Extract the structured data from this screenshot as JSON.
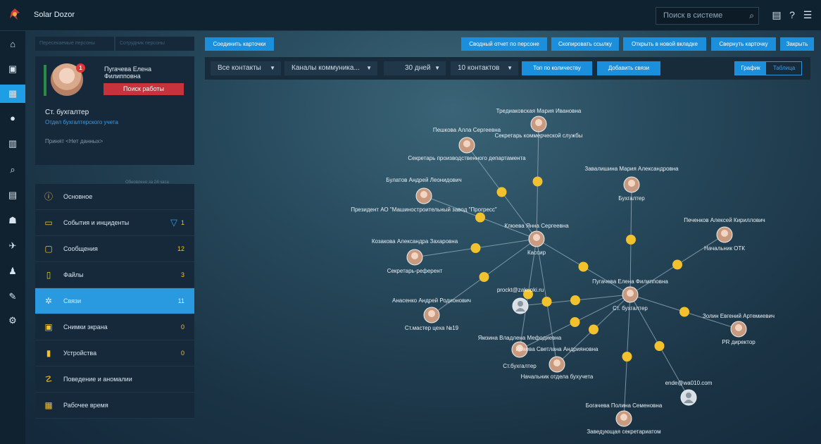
{
  "app": {
    "title": "Solar Dozor"
  },
  "search": {
    "placeholder": "Поиск в системе"
  },
  "colors": {
    "accent": "#1f9ee6",
    "badge": "#f2c12e",
    "danger": "#c8323a"
  },
  "left_nav": [
    "home-icon",
    "dashboard-icon",
    "persons-icon",
    "security-icon",
    "reports-icon",
    "search-icon",
    "table-icon",
    "spy-icon",
    "plane-icon",
    "user-icon",
    "edit-icon",
    "settings-icon"
  ],
  "panel_tabs": [
    "Пересекаемые персоны",
    "Сотрудник персоны"
  ],
  "profile": {
    "name": "Пугачева Елена Филипповна",
    "badge": "1",
    "job_button": "Поиск работы",
    "role": "Ст. бухгалтер",
    "department": "Отдел бухгалтерского учета",
    "hired": "Принят <Нет данных>",
    "updated": "Обновлено за 24 часа"
  },
  "menu": [
    {
      "label": "Основное",
      "count": "",
      "icon": "info-icon"
    },
    {
      "label": "События и инциденты",
      "count": "1",
      "icon": "events-icon"
    },
    {
      "label": "Сообщения",
      "count": "12",
      "icon": "message-icon"
    },
    {
      "label": "Файлы",
      "count": "3",
      "icon": "file-icon"
    },
    {
      "label": "Связи",
      "count": "11",
      "icon": "links-icon"
    },
    {
      "label": "Снимки экрана",
      "count": "0",
      "icon": "screenshot-icon"
    },
    {
      "label": "Устройства",
      "count": "0",
      "icon": "device-icon"
    },
    {
      "label": "Поведение и аномалии",
      "count": "",
      "icon": "anomaly-icon"
    },
    {
      "label": "Рабочее время",
      "count": "",
      "icon": "worktime-icon"
    }
  ],
  "toolbar": {
    "connect": "Соединить карточки",
    "report": "Сводный отчет по персоне",
    "copy": "Скопировать ссылку",
    "open_tab": "Открыть в новой вкладке",
    "collapse": "Свернуть карточку",
    "close": "Закрыть"
  },
  "filters": {
    "contacts": "Все контакты",
    "channels": "Каналы коммуника...",
    "period": "30 дней",
    "limit": "10 контактов",
    "sort": "Топ по количеству",
    "add": "Добавить связи",
    "view_graph": "График",
    "view_table": "Таблица"
  },
  "graph": {
    "center": {
      "name": "Пугачева Елена Филипповна",
      "role": "Ст. бухгалтер"
    },
    "hub": {
      "name": "Клюева Янна Сергеевна",
      "role": "Кассир"
    },
    "nodes": [
      {
        "name": "Тредиаковская Мария Ивановна",
        "role": "Секретарь коммерческой службы"
      },
      {
        "name": "Пешкова Алла Сергеевна",
        "role": "Секретарь производственного департамента"
      },
      {
        "name": "Булатов Андрей Леонидович",
        "role": "Президент АО \"Машиностроительный завод \"Прогресс\""
      },
      {
        "name": "Завалишина Мария Александровна",
        "role": "Бухгалтер"
      },
      {
        "name": "Козакова Александра Захаровна",
        "role": "Секретарь-референт"
      },
      {
        "name": "Печенков Алексей Кириллович",
        "role": "Начальник ОТК"
      },
      {
        "name": "prockt@zakupki.ru",
        "role": ""
      },
      {
        "name": "Анасенко Андрей Родионович",
        "role": "Ст.мастер цеха №19"
      },
      {
        "name": "Золин Евгений Артемиевич",
        "role": "PR директор"
      },
      {
        "name": "Ямзина Владлена Мефодиевна",
        "role": "Ст.бухгалтер"
      },
      {
        "name": "Исаева Светлана Андрияновна",
        "role": "Начальник отдела бухучета"
      },
      {
        "name": "ende@wa010.com",
        "role": ""
      },
      {
        "name": "Богачева Полина Семеновна",
        "role": "Заведующая секретариатом"
      }
    ]
  }
}
